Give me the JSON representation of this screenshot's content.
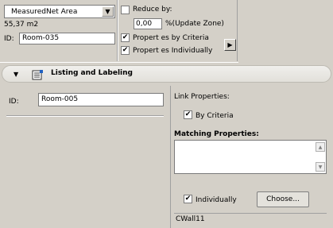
{
  "top": {
    "area_type_value": "MeasuredNet Area",
    "area_value": "55,37 m2",
    "reduce_label": "Reduce by:",
    "reduce_value": "0,00",
    "reduce_unit": "%(Update Zone)",
    "id_label": "ID:",
    "id_value": "Room-035",
    "properties_by_criteria_label": "Propert es by Criteria",
    "properties_individually_label": "Propert es Individually",
    "reduce_checked": false,
    "properties_by_criteria_checked": true,
    "properties_individually_checked": true
  },
  "section": {
    "title": "Listing and Labeling",
    "toggle_icon": "triangle-down",
    "icon": "listing-icon"
  },
  "listing": {
    "id_label": "ID:",
    "id_value": "Room-005",
    "link_properties_label": "Link Properties:",
    "by_criteria_label": "By Criteria",
    "by_criteria_checked": true,
    "matching_properties_label": "Matching Properties:",
    "individually_label": "Individually",
    "individually_checked": true,
    "choose_button_label": "Choose...",
    "status_text": "CWall11"
  },
  "glyphs": {
    "check": "✔",
    "dropdown": "▼",
    "right_arrow": "▶",
    "section_toggle": "▼",
    "scroll_up": "▲",
    "scroll_down": "▼"
  }
}
